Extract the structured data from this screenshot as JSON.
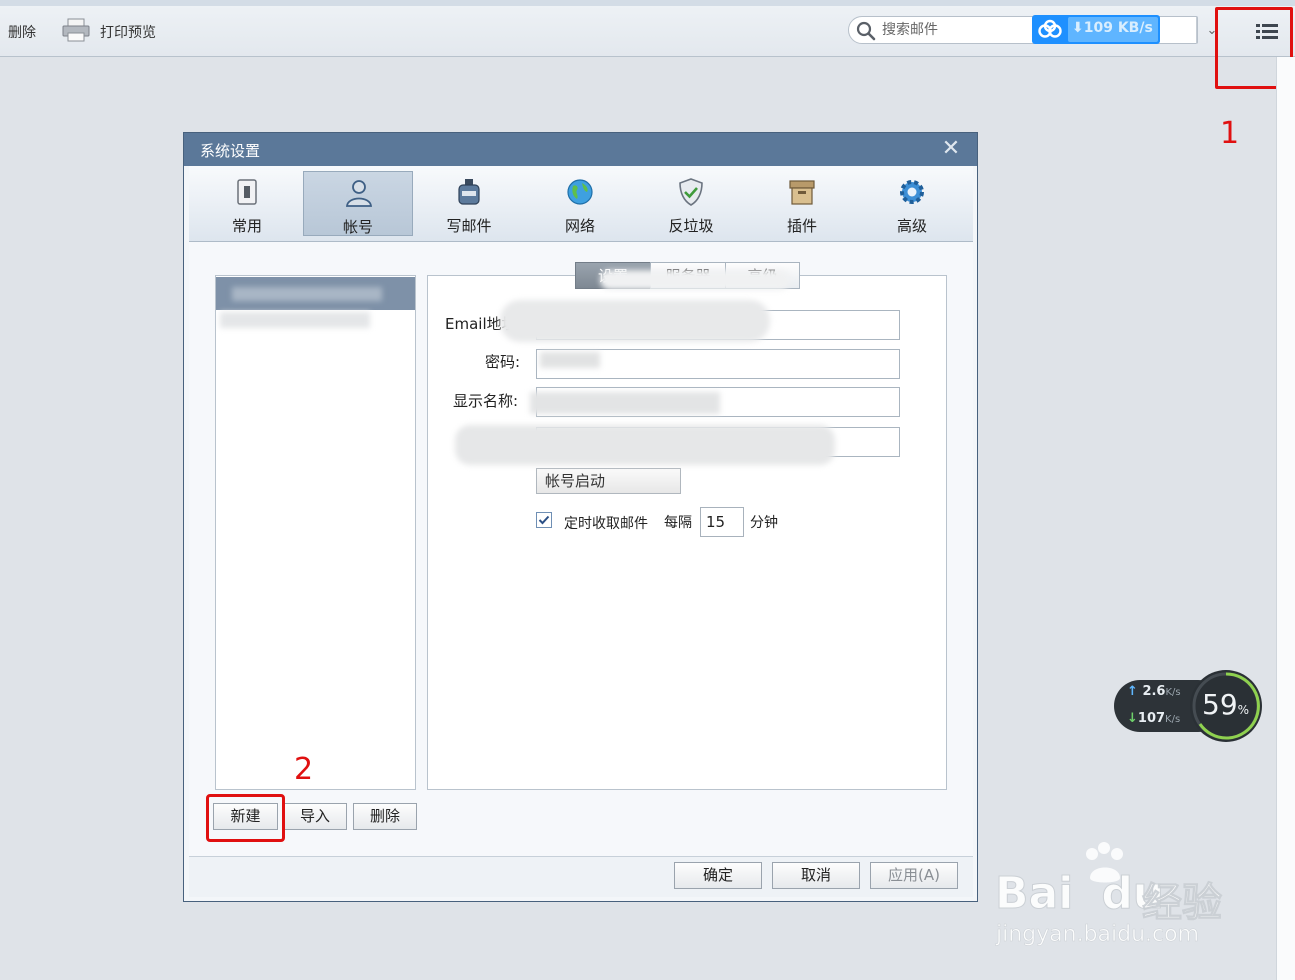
{
  "toolbar": {
    "delete_label": "删除",
    "print_preview_label": "打印预览",
    "search_placeholder": "搜索邮件",
    "download_speed": "109 KB/s"
  },
  "annotations": {
    "step1": "1",
    "step2": "2",
    "color": "#e01010"
  },
  "dialog": {
    "title": "系统设置",
    "close_glyph": "✕",
    "tabs": [
      {
        "label": "常用",
        "icon": "switch-icon"
      },
      {
        "label": "帐号",
        "icon": "person-icon",
        "active": true
      },
      {
        "label": "写邮件",
        "icon": "ink-bottle-icon"
      },
      {
        "label": "网络",
        "icon": "globe-icon"
      },
      {
        "label": "反垃圾",
        "icon": "shield-icon"
      },
      {
        "label": "插件",
        "icon": "box-icon"
      },
      {
        "label": "高级",
        "icon": "gear-icon"
      }
    ],
    "sub_tabs": [
      "设置",
      "服务器",
      "高级"
    ],
    "fields": {
      "email_label": "Email地址:",
      "password_label": "密码:",
      "display_name_label": "显示名称:"
    },
    "activate_button": "帐号启动",
    "auto_receive": {
      "checked": true,
      "label": "定时收取邮件",
      "every_label": "每隔",
      "interval": "15",
      "unit": "分钟"
    },
    "list_buttons": {
      "new": "新建",
      "import": "导入",
      "delete": "删除"
    },
    "footer_buttons": {
      "ok": "确定",
      "cancel": "取消",
      "apply": "应用(A)"
    }
  },
  "speed_widget": {
    "upload": "2.6",
    "upload_unit": "K/s",
    "download": "107",
    "download_unit": "K/s",
    "cpu_percent": "59",
    "percent_sign": "%"
  },
  "watermark": {
    "brand": "Bai",
    "brand2": "du",
    "cn": "经验",
    "url": "jingyan.baidu.com"
  }
}
